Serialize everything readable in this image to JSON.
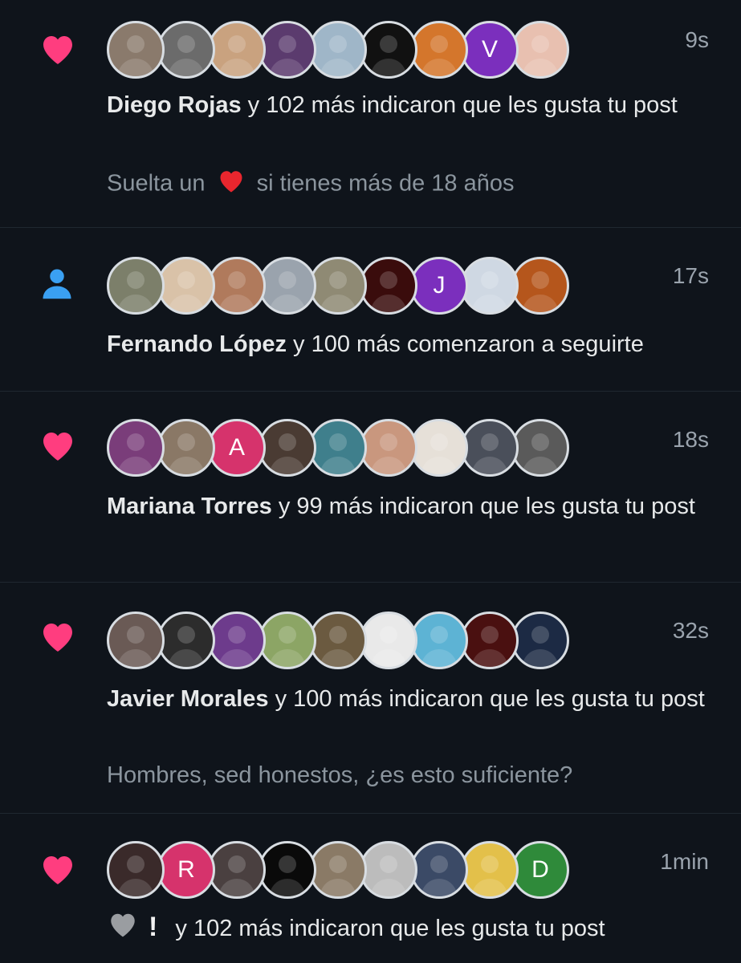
{
  "colors": {
    "background": "#0f141b",
    "like_heart": "#ff3d7f",
    "follow_icon": "#3aa0f2",
    "text": "#e7e9ea",
    "muted": "#8b959e"
  },
  "notifications": [
    {
      "type": "like",
      "icon": "heart-icon",
      "time": "9s",
      "name": "Diego Rojas",
      "action": " y 102 más indicaron que les gusta tu post",
      "snippet_before": "Suelta un ",
      "snippet_after": " si tienes más de 18 años",
      "avatars": [
        {
          "bg": "#8a7a6c"
        },
        {
          "bg": "#6b6b6b"
        },
        {
          "bg": "#c9a27f"
        },
        {
          "bg": "#5b3b6e"
        },
        {
          "bg": "#9fb6c8"
        },
        {
          "bg": "#111111"
        },
        {
          "bg": "#d4762c"
        },
        {
          "letter": "V",
          "bg": "#7b2fbd"
        },
        {
          "bg": "#e8c0b0"
        }
      ]
    },
    {
      "type": "follow",
      "icon": "person-icon",
      "time": "17s",
      "name": "Fernando López",
      "action": " y 100 más comenzaron a seguirte",
      "avatars": [
        {
          "bg": "#7c7f6a"
        },
        {
          "bg": "#d9c2a8"
        },
        {
          "bg": "#b07a5c"
        },
        {
          "bg": "#9aa3ad"
        },
        {
          "bg": "#8f8a74"
        },
        {
          "bg": "#3a0c0c"
        },
        {
          "letter": "J",
          "bg": "#7b2fbd"
        },
        {
          "bg": "#cfd8e3"
        },
        {
          "bg": "#b5561c"
        }
      ]
    },
    {
      "type": "like",
      "icon": "heart-icon",
      "time": "18s",
      "name": "Mariana Torres",
      "action": " y 99 más indicaron que les gusta tu post",
      "avatars": [
        {
          "bg": "#7a3d7a"
        },
        {
          "bg": "#8a7866"
        },
        {
          "letter": "A",
          "bg": "#d6336c"
        },
        {
          "bg": "#4a3b33"
        },
        {
          "bg": "#3f7f8c"
        },
        {
          "bg": "#c9977e"
        },
        {
          "bg": "#e6e0d8"
        },
        {
          "bg": "#4a4f5a"
        },
        {
          "bg": "#5a5a5a"
        }
      ]
    },
    {
      "type": "like",
      "icon": "heart-icon",
      "time": "32s",
      "name": "Javier Morales",
      "action": " y 100 más indicaron que les gusta tu post",
      "snippet_before": "Hombres, sed honestos, ¿es esto suficiente?",
      "snippet_after": "",
      "avatars": [
        {
          "bg": "#6a5a55"
        },
        {
          "bg": "#2c2c2c"
        },
        {
          "bg": "#6d3b8c"
        },
        {
          "bg": "#8ca565"
        },
        {
          "bg": "#6b5a40"
        },
        {
          "bg": "#e9e9e9"
        },
        {
          "bg": "#5db3d4"
        },
        {
          "bg": "#4a1010"
        },
        {
          "bg": "#1c2a44"
        }
      ]
    },
    {
      "type": "like",
      "icon": "heart-icon",
      "time": "1min",
      "name": "",
      "action": " y 102 más indicaron que les gusta tu post",
      "avatars": [
        {
          "bg": "#3a2a2a"
        },
        {
          "letter": "R",
          "bg": "#d6336c"
        },
        {
          "bg": "#4a4040"
        },
        {
          "bg": "#0a0a0a"
        },
        {
          "bg": "#8a7a66"
        },
        {
          "bg": "#bcbcbc"
        },
        {
          "bg": "#3b4a66"
        },
        {
          "bg": "#e3c04a"
        },
        {
          "letter": "D",
          "bg": "#2f8a3a"
        }
      ]
    }
  ]
}
